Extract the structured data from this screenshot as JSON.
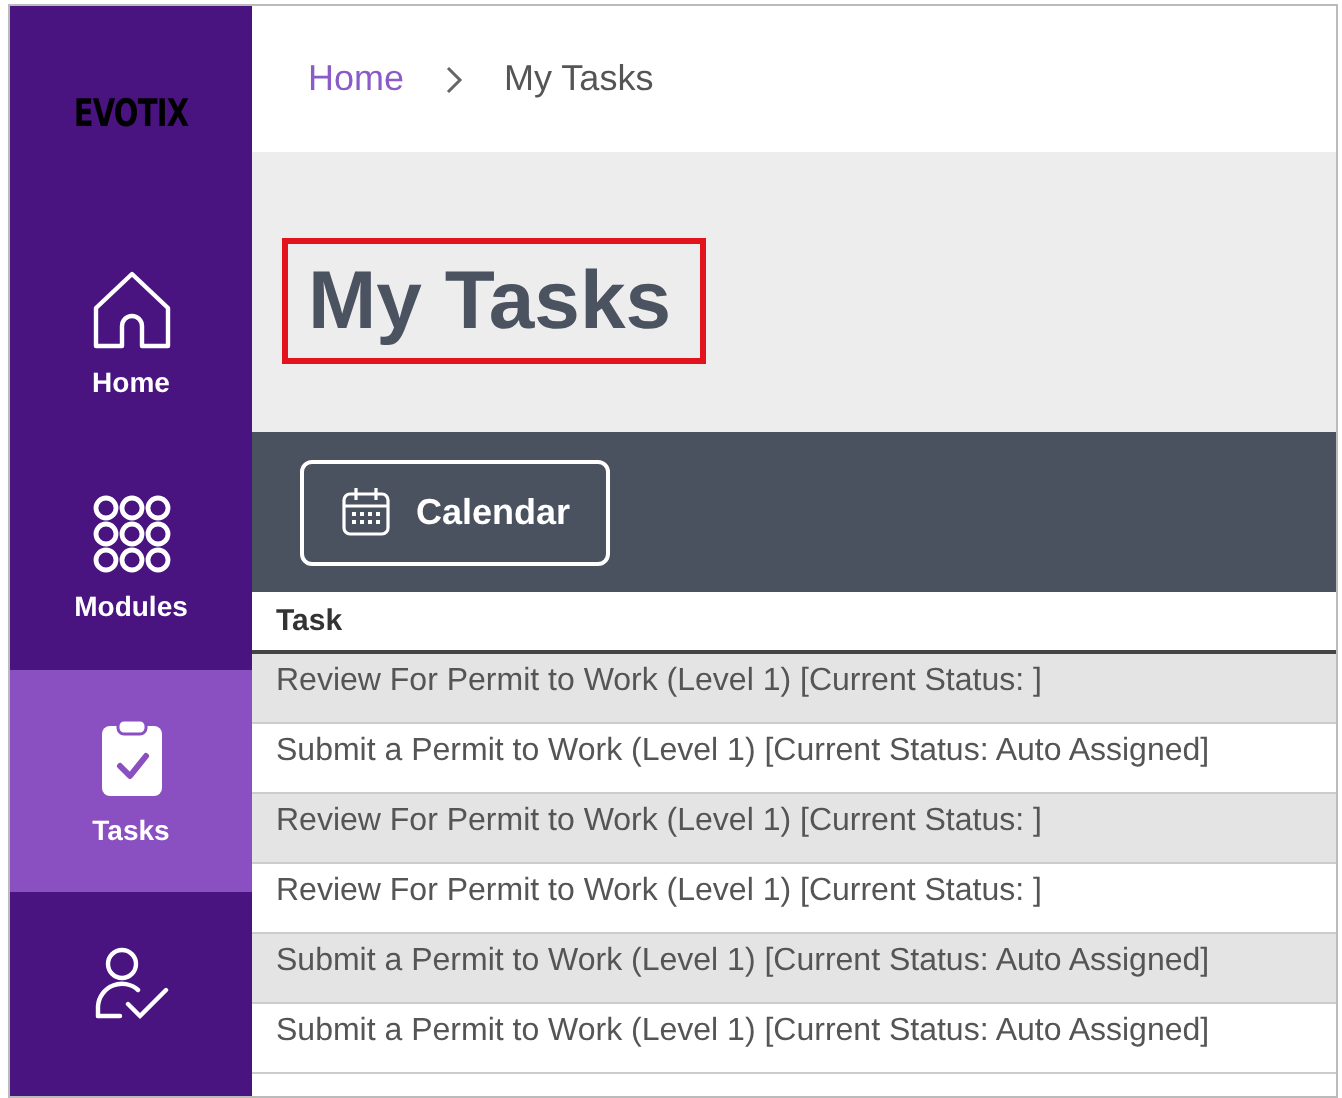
{
  "sidebar": {
    "logo": "EVOTIX",
    "items": [
      {
        "kind": "home",
        "label": "Home",
        "selected": false
      },
      {
        "kind": "modules",
        "label": "Modules",
        "selected": false
      },
      {
        "kind": "tasks",
        "label": "Tasks",
        "selected": true
      },
      {
        "kind": "user-check",
        "selected": false
      }
    ]
  },
  "breadcrumb": [
    {
      "label": "Home",
      "link": true
    },
    {
      "label": "My Tasks",
      "link": false
    }
  ],
  "page_title": {
    "text": "My Tasks",
    "highlighted": true
  },
  "toolbar": {
    "buttons": [
      {
        "kind": "calendar",
        "label": "Calendar"
      }
    ]
  },
  "table": {
    "columns": [
      "Task"
    ],
    "rows": [
      "Review For Permit to Work (Level 1) [Current Status: ]",
      "Submit a Permit to Work (Level 1) [Current Status: Auto Assigned]",
      "Review For Permit to Work (Level 1) [Current Status: ]",
      "Review For Permit to Work (Level 1) [Current Status: ]",
      "Submit a Permit to Work (Level 1) [Current Status: Auto Assigned]",
      "Submit a Permit to Work (Level 1) [Current Status: Auto Assigned]"
    ]
  }
}
